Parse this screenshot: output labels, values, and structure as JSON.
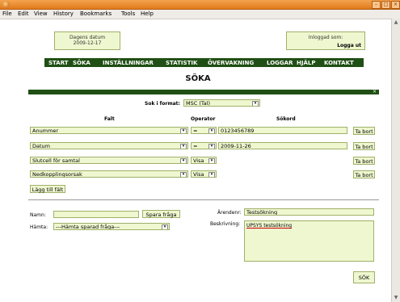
{
  "browser": {
    "menu": [
      "File",
      "Edit",
      "View",
      "History",
      "Bookmarks",
      "Tools",
      "Help"
    ]
  },
  "header": {
    "date_label": "Dagens datum",
    "date_value": "2009-12-17",
    "login_label": "Inloggad som:",
    "logout": "Logga ut"
  },
  "nav": [
    "START",
    "SÖKA",
    "INSTÄLLNINGAR",
    "STATISTIK",
    "ÖVERVAKNING",
    "LOGGAR",
    "HJÄLP",
    "KONTAKT"
  ],
  "page_title": "SÖKA",
  "dialog": {
    "close": "×",
    "format_label": "Sok i format:",
    "format_value": "MSC (Tal)",
    "col_field": "Falt",
    "col_operator": "Operator",
    "col_keyword": "Sökord",
    "rows": [
      {
        "field": "Anummer",
        "operator": "=",
        "keyword": "0123456789",
        "remove": "Ta bort"
      },
      {
        "field": "Datum",
        "operator": "=",
        "keyword": "2009-11-26",
        "remove": "Ta bort"
      },
      {
        "field": "Slutcell för samtal",
        "operator": "Visa",
        "keyword": "",
        "remove": "Ta bort"
      },
      {
        "field": "Nedkopplingsorsak",
        "operator": "Visa",
        "keyword": "",
        "remove": "Ta bort"
      }
    ],
    "add_field": "Lägg till fält",
    "name_label": "Namn:",
    "name_value": "",
    "save_query": "Spara fråga",
    "fetch_label": "Hämta:",
    "fetch_value": "---Hämta sparad fråga---",
    "case_label": "Ärendenr:",
    "case_value": "Testsökning",
    "desc_label": "Beskrivning:",
    "desc_value": "UPSYS testsökning",
    "search_button": "SÖK"
  },
  "colors": {
    "nav_bg": "#1f4f14",
    "field_bg": "#eef7cf",
    "field_border": "#9fb06a",
    "titlebar": "#e07a1a"
  }
}
